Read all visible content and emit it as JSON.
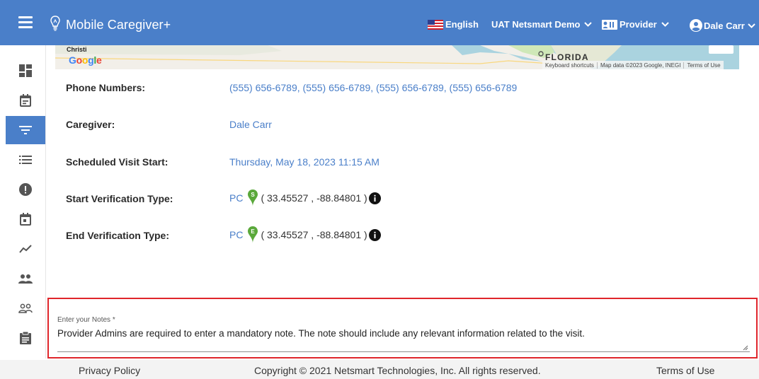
{
  "header": {
    "menu_icon": "hamburger-menu-icon",
    "logo_icon": "lightbulb-logo-icon",
    "title": "Mobile Caregiver+",
    "language": "English",
    "account": "UAT Netsmart Demo",
    "role": "Provider",
    "user": "Dale Carr",
    "colors": {
      "bar": "#4a7fc9",
      "text": "#ffffff"
    }
  },
  "sidebar": {
    "items": [
      {
        "icon": "dashboard-icon"
      },
      {
        "icon": "calendar-icon"
      },
      {
        "icon": "filter-icon",
        "active": true
      },
      {
        "icon": "list-icon"
      },
      {
        "icon": "alert-icon"
      },
      {
        "icon": "event-icon"
      },
      {
        "icon": "trending-icon"
      },
      {
        "icon": "people-icon"
      },
      {
        "icon": "people-outline-icon"
      },
      {
        "icon": "clipboard-icon"
      }
    ]
  },
  "map": {
    "city_label": "Christi",
    "google_logo": "Google",
    "state_label": "FLORIDA",
    "attribution": {
      "shortcuts": "Keyboard shortcuts",
      "data": "Map data ©2023 Google, INEGI",
      "terms": "Terms of Use"
    }
  },
  "details": {
    "phone_label": "Phone Numbers:",
    "phone_value": "(555) 656-6789, (555) 656-6789, (555) 656-6789, (555) 656-6789",
    "caregiver_label": "Caregiver:",
    "caregiver_value": "Dale Carr",
    "scheduled_label": "Scheduled Visit Start:",
    "scheduled_value": "Thursday, May 18, 2023 11:15 AM",
    "start_label": "Start Verification Type:",
    "start_type": "PC",
    "start_pin_letter": "S",
    "start_coords": "( 33.45527 , -88.84801 )",
    "end_label": "End Verification Type:",
    "end_type": "PC",
    "end_pin_letter": "E",
    "end_coords": "( 33.45527 , -88.84801 )",
    "colors": {
      "value": "#4a7fc9",
      "pin": "#5aa83a"
    }
  },
  "notes": {
    "label": "Enter your Notes *",
    "value": "Provider Admins are required to enter a mandatory note. The note should include any relevant information related to the visit.",
    "highlight_color": "#e0262b"
  },
  "footer": {
    "privacy": "Privacy Policy",
    "copyright": "Copyright © 2021 Netsmart Technologies, Inc. All rights reserved.",
    "terms": "Terms of Use"
  }
}
